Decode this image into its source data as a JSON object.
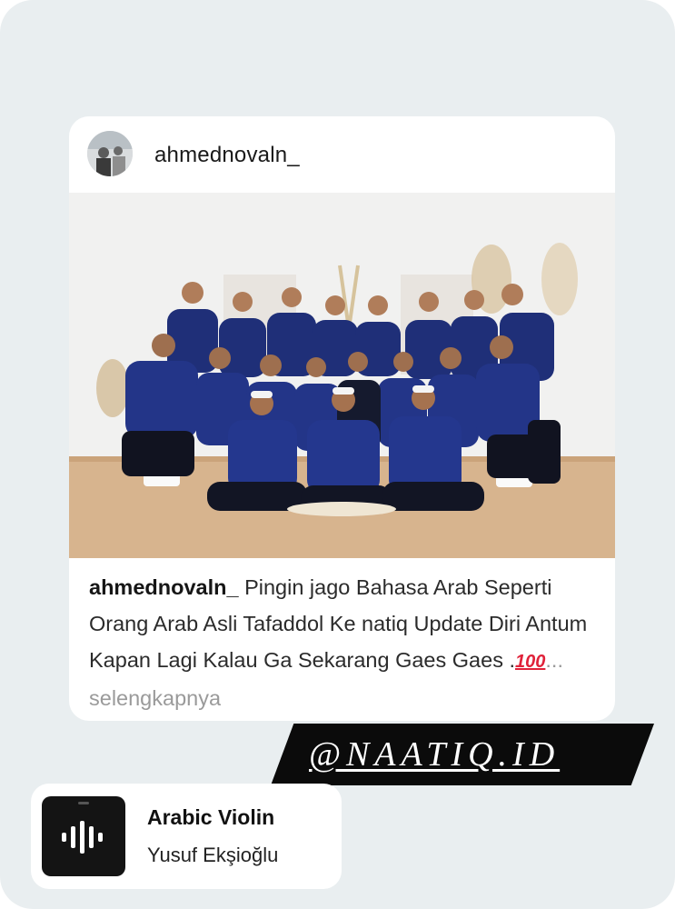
{
  "post": {
    "username": "ahmednovaln_",
    "caption_user": "ahmednovaln_",
    "caption_text": " Pingin jago Bahasa Arab Seperti Orang Arab Asli Tafaddol Ke natiq Update Diri Antum Kapan Lagi Kalau Ga Sekarang Gaes Gaes .",
    "caption_emoji": "100",
    "more_label": "... selengkapnya"
  },
  "watermark": {
    "text": "@NAATIQ.ID"
  },
  "music": {
    "title": "Arabic Violin",
    "artist": "Yusuf Ekşioğlu"
  },
  "icons": {
    "music_art": "audio-waveform-icon",
    "emoji": "hundred-points-icon"
  }
}
